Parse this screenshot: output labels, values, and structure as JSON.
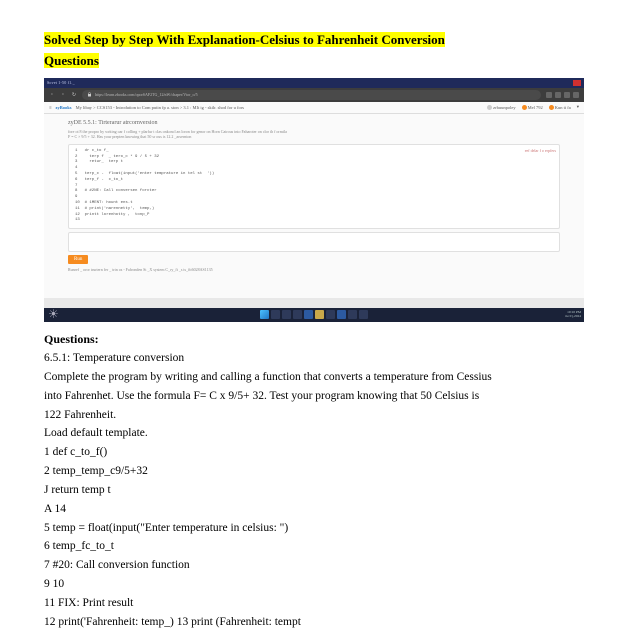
{
  "title_line1": "Solved Step by Step With  Explanation-Celsius to Fahrenheit Conversion",
  "title_line2": "Questions",
  "window": {
    "tab": "  Sovet 1-50 f1._",
    "url": "https://learn.zbooks.com/oporSAF2TG_12/nW/chaper/Vtor_o/5"
  },
  "bookmarks": {
    "brand": "zyBooks",
    "crumbs": "My libay > CCS153 - Introdution to Com putin fp a. ston > 3.1 : MIt ig - skilr. shod for u fors",
    "r1": "zrbuunpoley",
    "r2": "Mel 792",
    "r3": "Kun ti fa"
  },
  "problem": {
    "title": "zyDE  5.5.1: Tirterarur atrcornversion",
    "desc1": "fore ot 8 the propro by writing oar f colling + plarfur t clas onkoncl an loron for genor on Horn Cairous into Faharoter on  clor th f ormila",
    "desc2": "F = C × 9/5 + 32. Has your prepten knowing that 50 sr ous is 12.2 _arsernton",
    "load": "eef delar f o erpfers"
  },
  "code": {
    "l1": "1   dr c_to f_",
    "l2": "2     terp f  _ tero_c * 9 / 5 + 32",
    "l3": "3     retur_  terp t",
    "l4": "4 ",
    "l5": "5   terp_c -  float(input('enter temprature in tel st  '))",
    "l6": "6   terp_f -  c_to_t",
    "l7": "7 ",
    "l8": "8   # #2NE: Call conversen forcter",
    "l9": "9 ",
    "l10": "10  # 1MENT: hount ens.t",
    "l11": "11  # print('narennetty',  temp,)",
    "l12": "12  printt lorenhotty ,  tonp_P",
    "l13": "13"
  },
  "run": "Run",
  "output": "Runref _ oror trurtern fer _ trtn os - Fafronden St _X system C_ry_ft _s ts_ftt6028AS1135",
  "clock": {
    "t": "10:10 PM",
    "d": "tte 0},2024"
  },
  "questions": {
    "heading": "Questions:",
    "lines": [
      "6.5.1: Temperature conversion",
      "Complete the program by writing and calling a function that converts a temperature from Cessius",
      "into Fahrenhet. Use the formula F= C x 9/5+ 32. Test your program knowing that 50 Celsius is",
      "122 Fahrenheit.",
      "Load default template.",
      "1 def c_to_f()",
      "2 temp_temp_c9/5+32",
      "J return temp t",
      "A 14",
      "5 temp = float(input(\"Enter temperature in celsius: \")",
      "6 temp_fc_to_t",
      "7 #20: Call conversion function",
      "9 10",
      "11 FIX: Print result",
      "12 print('Fahrenheit: temp_) 13 print (Fahrenheit: tempt"
    ]
  }
}
